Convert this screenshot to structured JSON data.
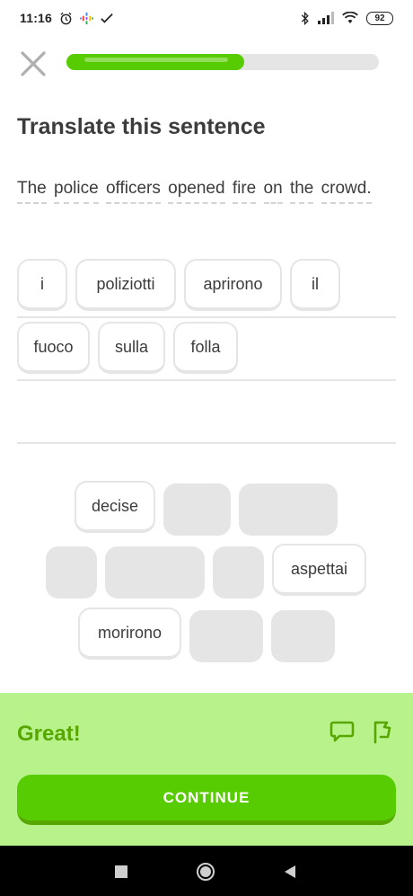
{
  "status_bar": {
    "time": "11:16",
    "battery": "92",
    "icons": [
      "alarm-icon",
      "podcast-icon",
      "check-icon",
      "bluetooth-icon",
      "signal-icon",
      "wifi-icon",
      "battery-icon"
    ]
  },
  "header": {
    "close_icon": "close-icon",
    "progress_fraction": 0.57
  },
  "challenge": {
    "title": "Translate this sentence",
    "sentence_words": [
      "The",
      "police",
      "officers",
      "opened",
      "fire",
      "on",
      "the",
      "crowd."
    ]
  },
  "answer_tiles": [
    "i",
    "poliziotti",
    "aprirono",
    "il",
    "fuoco",
    "sulla",
    "folla"
  ],
  "word_bank": {
    "available": [
      "decise",
      "aspettai",
      "morirono"
    ]
  },
  "feedback": {
    "title": "Great!",
    "discuss_icon": "comment-icon",
    "report_icon": "flag-icon",
    "continue_label": "CONTINUE"
  },
  "nav_bar": {
    "icons": [
      "recent-apps-icon",
      "home-icon",
      "back-icon"
    ]
  },
  "colors": {
    "primary_green": "#58cc02",
    "dark_green": "#58a700",
    "feedback_bg": "#b8f28b",
    "tile_border": "#e5e5e5",
    "text": "#3c3c3c"
  }
}
